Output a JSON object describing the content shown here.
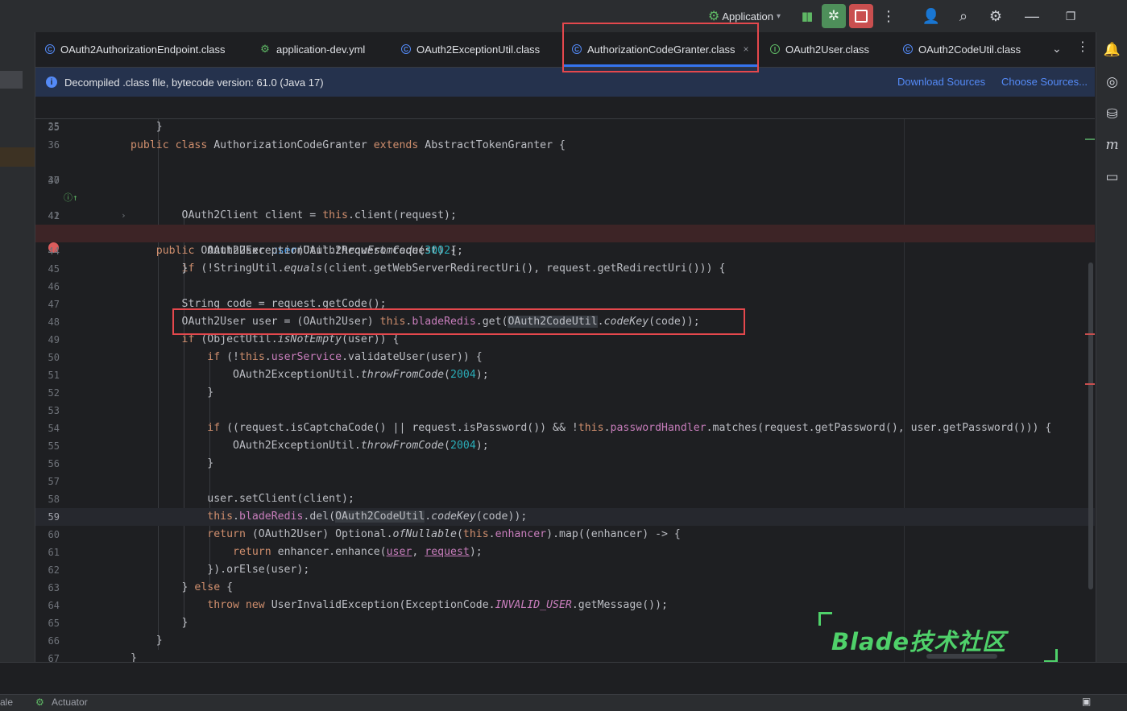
{
  "titlebar": {
    "run_config": "Application",
    "icons": [
      "pause-icon",
      "debug-icon",
      "stop-icon",
      "more-vertical-icon",
      "add-user-icon",
      "search-icon",
      "settings-icon",
      "minimize-icon",
      "restore-icon"
    ]
  },
  "tabs": [
    {
      "label": "OAuth2AuthorizationEndpoint.class",
      "icon": "class-icon"
    },
    {
      "label": "application-dev.yml",
      "icon": "yaml-icon"
    },
    {
      "label": "OAuth2ExceptionUtil.class",
      "icon": "class-icon"
    },
    {
      "label": "AuthorizationCodeGranter.class",
      "icon": "class-icon",
      "active": true,
      "close": "×"
    },
    {
      "label": "OAuth2User.class",
      "icon": "interface-icon"
    },
    {
      "label": "OAuth2CodeUtil.class",
      "icon": "class-icon"
    }
  ],
  "banner": {
    "message": "Decompiled .class file, bytecode version: 61.0 (Java 17)",
    "download_sources": "Download Sources",
    "choose_sources": "Choose Sources..."
  },
  "editor": {
    "sticky_line_number": "25",
    "line_numbers": [
      "35",
      "36",
      "37",
      "40",
      "41",
      "42",
      "43",
      "44",
      "45",
      "46",
      "47",
      "48",
      "49",
      "50",
      "51",
      "52",
      "53",
      "54",
      "55",
      "56",
      "57",
      "58",
      "59",
      "60",
      "61",
      "62",
      "63",
      "64",
      "65",
      "66",
      "67"
    ],
    "breakpoint_line": "43",
    "current_line": "59"
  },
  "watermark": "Blade技术社区",
  "statusbar": {
    "left_text": "ale",
    "actuator": "Actuator"
  },
  "colors": {
    "keyword": "#cf8e6d",
    "method": "#56a8f5",
    "string": "#6aab73",
    "number": "#2aacb8",
    "field": "#c77dbb",
    "highlight_box": "#e5484d",
    "watermark": "#4fd16a"
  }
}
